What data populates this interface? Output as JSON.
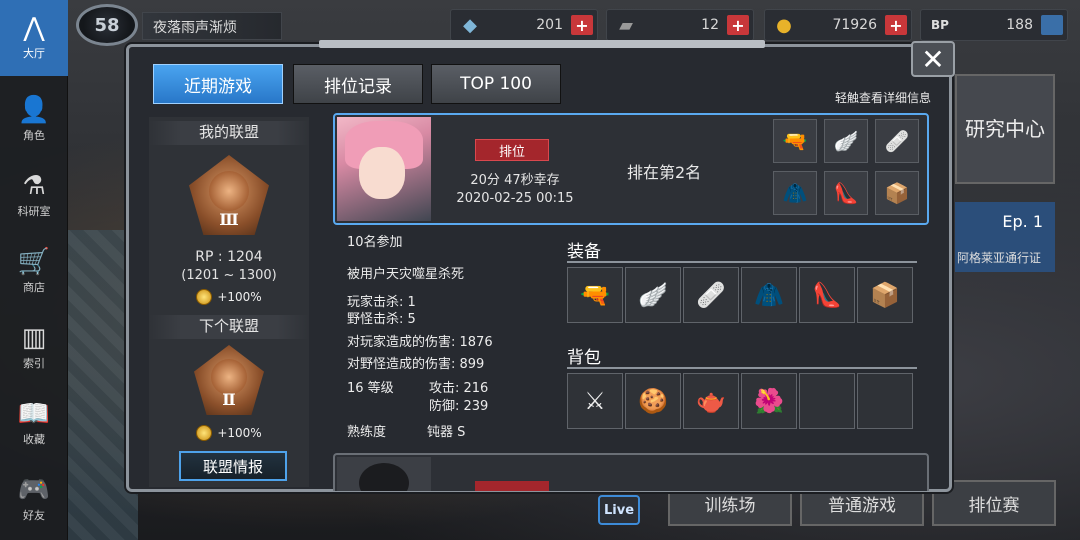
{
  "sidebar": {
    "items": [
      {
        "label": "大厅",
        "icon": "lobby-icon",
        "glyph": "⋀"
      },
      {
        "label": "角色",
        "icon": "character-icon",
        "glyph": "👤"
      },
      {
        "label": "科研室",
        "icon": "flask-icon",
        "glyph": "⚗"
      },
      {
        "label": "商店",
        "icon": "cart-icon",
        "glyph": "🛒"
      },
      {
        "label": "索引",
        "icon": "books-icon",
        "glyph": "▥"
      },
      {
        "label": "收藏",
        "icon": "book-icon",
        "glyph": "📖"
      },
      {
        "label": "好友",
        "icon": "gamepad-icon",
        "glyph": "🎮"
      }
    ]
  },
  "topbar": {
    "level": "58",
    "player_name": "夜落雨声渐烦",
    "resources": [
      {
        "icon": "crystal-icon",
        "glyph": "◆",
        "value": "201"
      },
      {
        "icon": "card-icon",
        "glyph": "▰",
        "value": "12"
      },
      {
        "icon": "coin-icon",
        "glyph": "●",
        "value": "71926"
      },
      {
        "icon": "bp-icon",
        "glyph": "BP",
        "value": "188"
      }
    ]
  },
  "modal": {
    "tabs": [
      "近期游戏",
      "排位记录",
      "TOP 100"
    ],
    "active_tab": "近期游戏",
    "hint": "轻触查看详细信息",
    "close_glyph": "✕"
  },
  "alliance": {
    "my_title": "我的联盟",
    "my_rank_numeral": "Ⅲ",
    "rp": "RP : 1204",
    "rp_range": "(1201 ~ 1300)",
    "my_bonus": "+100%",
    "next_title": "下个联盟",
    "next_rank_numeral": "Ⅱ",
    "next_bonus": "+100%",
    "info_button": "联盟情报"
  },
  "match": {
    "mode_tag": "排位",
    "survival": "20分 47秒幸存",
    "datetime": "2020-02-25 00:15",
    "placement": "排在第2名",
    "mini_items": [
      {
        "name": "gun-icon",
        "glyph": "🔫"
      },
      {
        "name": "wings-icon",
        "glyph": "🪽"
      },
      {
        "name": "bandage-icon",
        "glyph": "🩹"
      },
      {
        "name": "cloak-icon",
        "glyph": "🧥"
      },
      {
        "name": "shoes-icon",
        "glyph": "👠"
      },
      {
        "name": "box-icon",
        "glyph": "📦"
      }
    ]
  },
  "stats": {
    "participants": "10名参加",
    "killed_by": "被用户天灾噬星杀死",
    "player_kills": "玩家击杀: 1",
    "monster_kills": "野怪击杀: 5",
    "player_damage": "对玩家造成的伤害: 1876",
    "monster_damage": "对野怪造成的伤害: 899",
    "level": "16 等级",
    "attack": "攻击: 216",
    "defense": "防御: 239",
    "proficiency_label": "熟练度",
    "proficiency_value": "钝器 S"
  },
  "equipment": {
    "title": "装备",
    "items": [
      {
        "name": "gun-icon",
        "glyph": "🔫"
      },
      {
        "name": "wings-icon",
        "glyph": "🪽"
      },
      {
        "name": "bandage-icon",
        "glyph": "🩹"
      },
      {
        "name": "cloak-icon",
        "glyph": "🧥"
      },
      {
        "name": "shoes-icon",
        "glyph": "👠"
      },
      {
        "name": "box-icon",
        "glyph": "📦"
      }
    ]
  },
  "backpack": {
    "title": "背包",
    "items": [
      {
        "name": "blades-icon",
        "glyph": "⚔"
      },
      {
        "name": "food-plate-icon",
        "glyph": "🍪"
      },
      {
        "name": "teapot-icon",
        "glyph": "🫖"
      },
      {
        "name": "flower-icon",
        "glyph": "🌺"
      },
      {
        "name": "empty-slot",
        "glyph": ""
      },
      {
        "name": "empty-slot",
        "glyph": ""
      }
    ]
  },
  "right": {
    "research_center": "研究中心",
    "ep_label": "Ep. 1",
    "ep_subtitle": "阿格莱亚通行证"
  },
  "bottom_modes": [
    "训练场",
    "普通游戏",
    "排位赛"
  ],
  "live_label": "Live"
}
